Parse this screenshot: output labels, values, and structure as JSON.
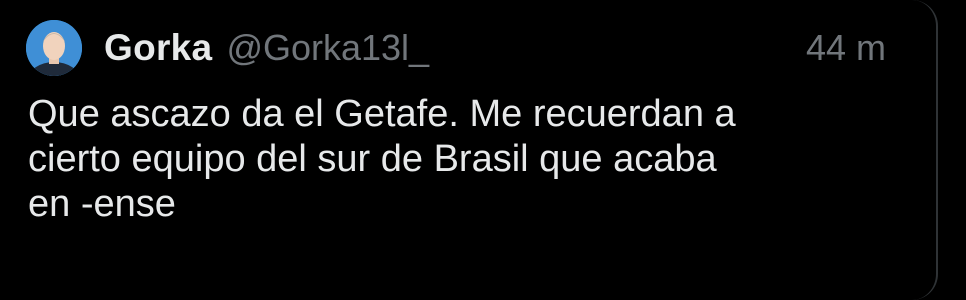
{
  "tweet": {
    "author_name": "Gorka",
    "handle": "@Gorka13l_",
    "time": "44 m",
    "text_lines": [
      "Que ascazo da el Getafe. Me recuerdan a",
      "cierto equipo del sur de Brasil que acaba",
      "en -ense"
    ],
    "avatar_icon": "profile-photo"
  },
  "colors": {
    "background": "#000000",
    "primary_text": "#e7e9ea",
    "secondary_text": "#71767b",
    "avatar_bg": "#1d9bf0"
  }
}
